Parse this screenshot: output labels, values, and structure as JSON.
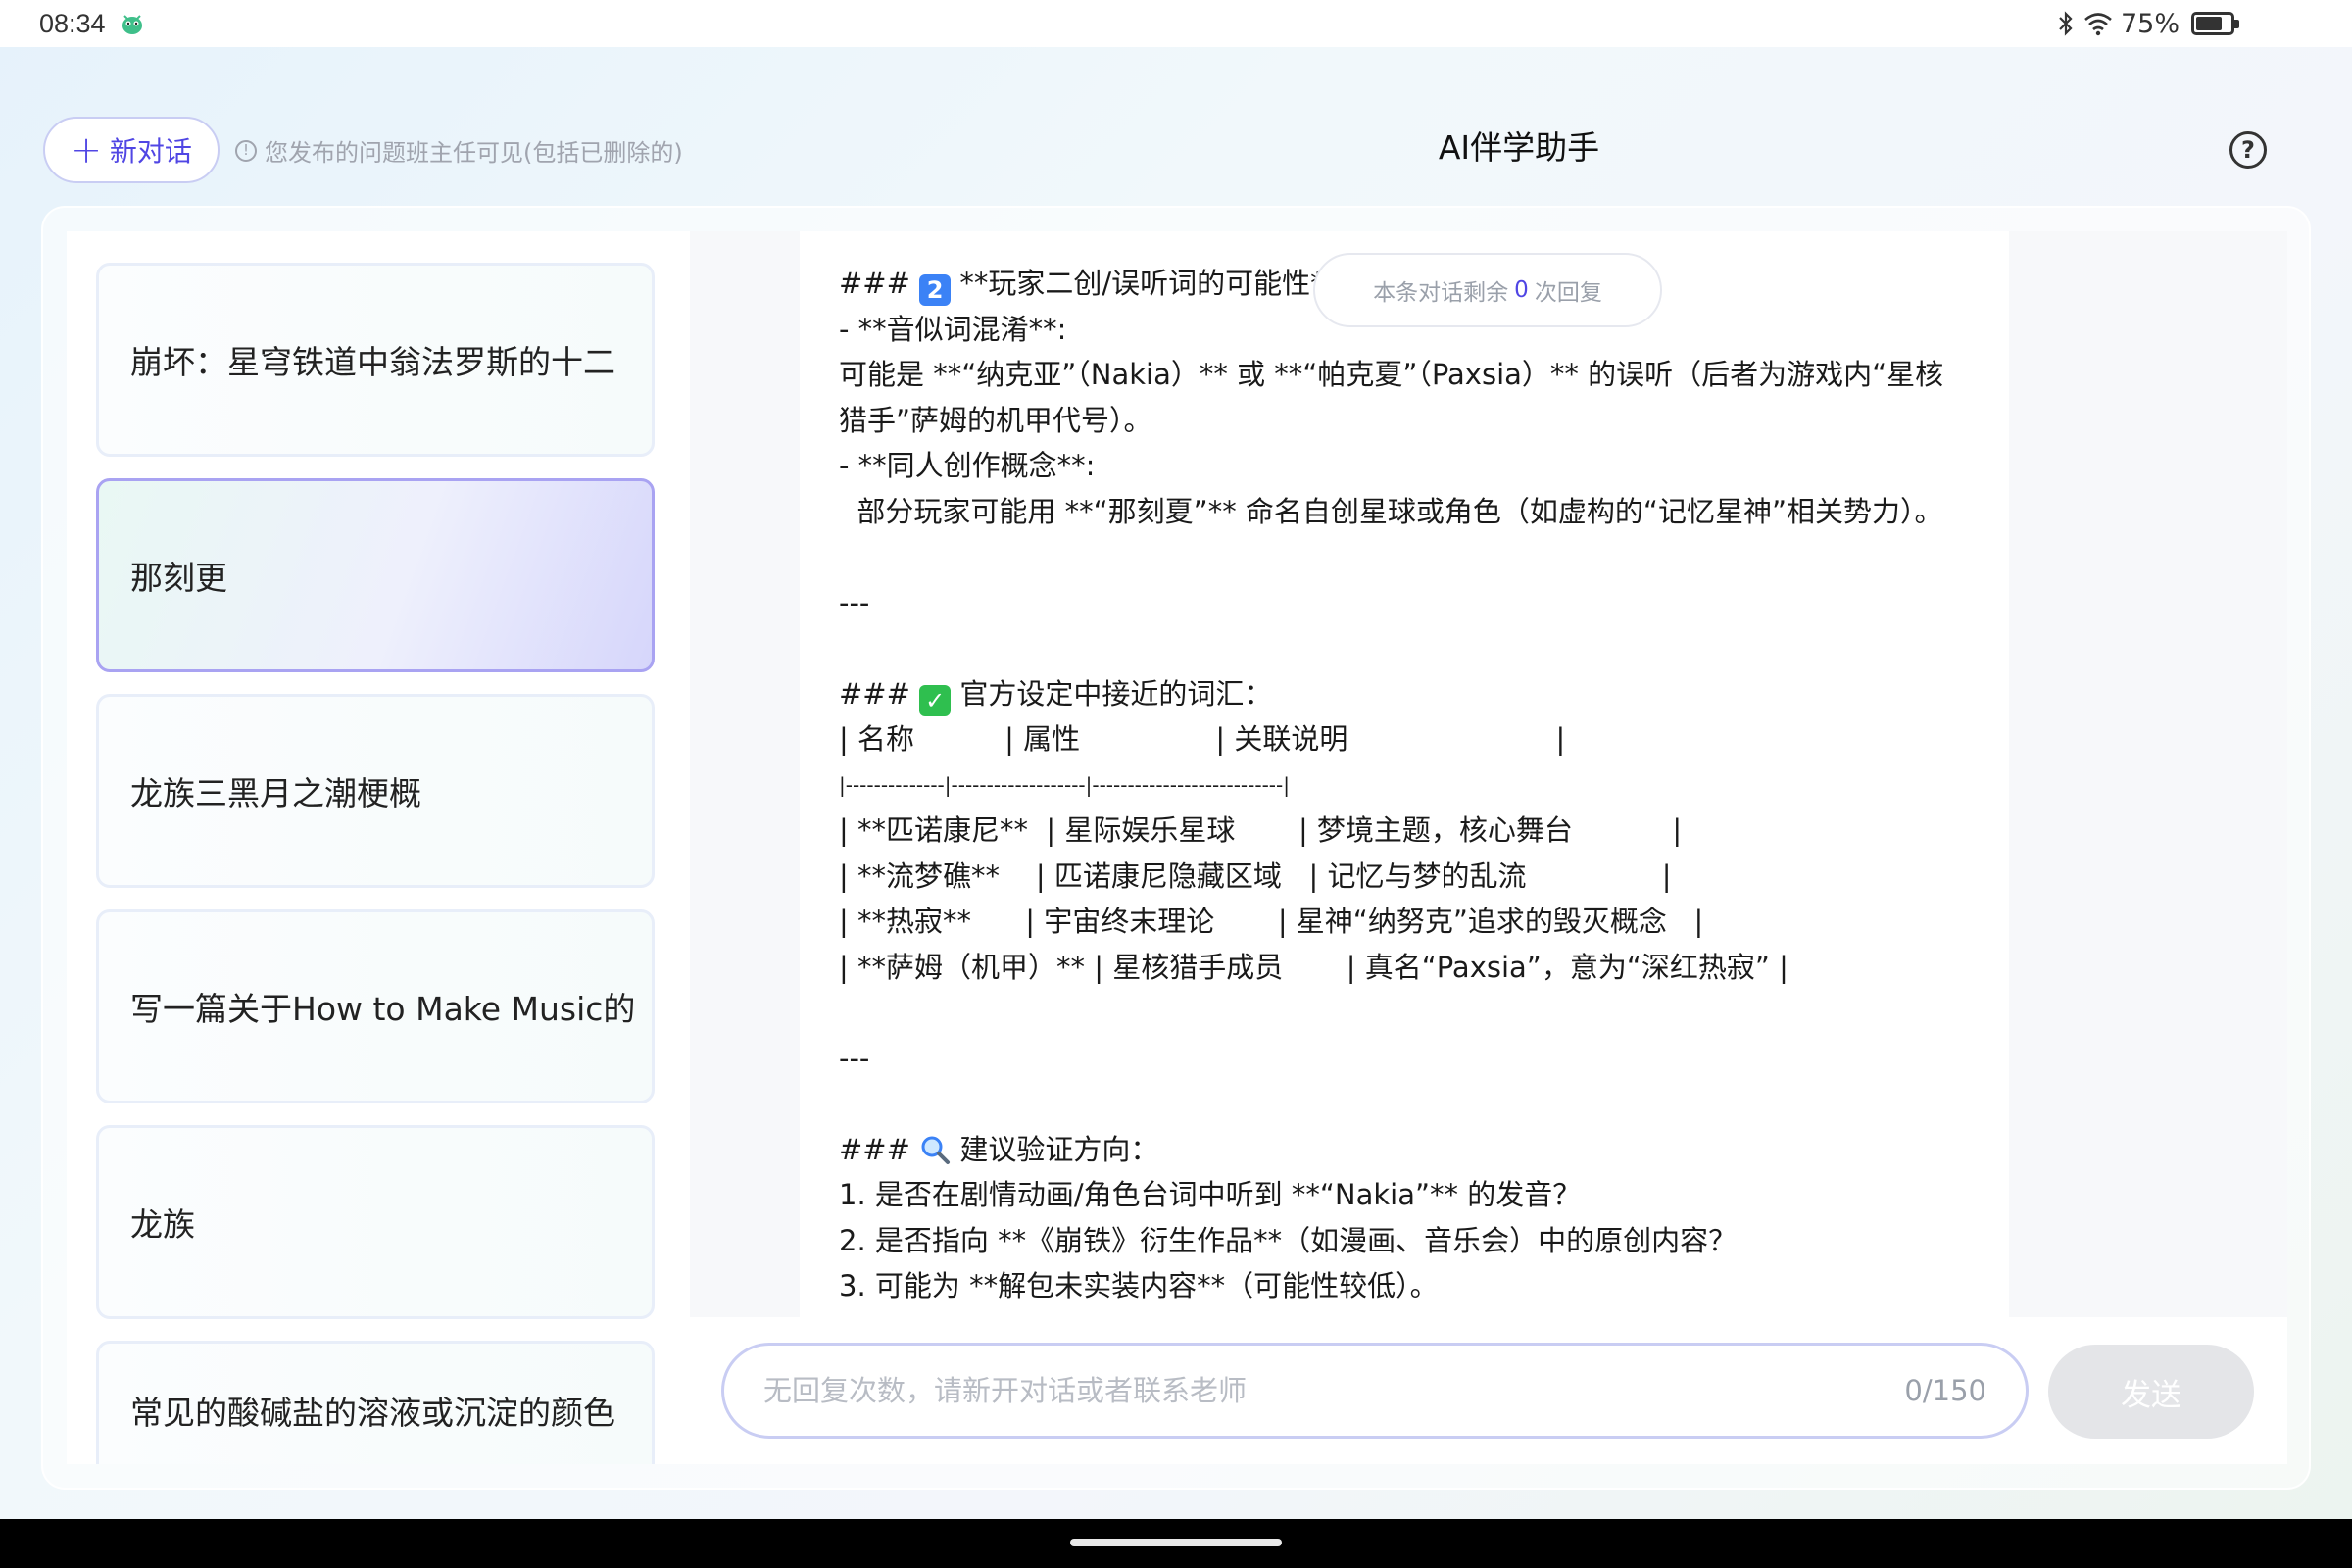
{
  "status_bar": {
    "time": "08:34",
    "battery": "75%",
    "battery_level": 0.75,
    "icons": [
      "bug-icon",
      "bluetooth-icon",
      "wifi-icon",
      "battery-icon"
    ]
  },
  "header": {
    "new_chat_label": "新对话",
    "notice": "您发布的问题班主任可见(包括已删除的)",
    "title": "AI伴学助手"
  },
  "sidebar": {
    "items": [
      {
        "label": "崩坏：星穹铁道中翁法罗斯的十二"
      },
      {
        "label": "那刻更"
      },
      {
        "label": "龙族三黑月之潮梗概"
      },
      {
        "label": "写一篇关于How to Make Music的"
      },
      {
        "label": "龙族"
      },
      {
        "label": "常见的酸碱盐的溶液或沉淀的颜色"
      }
    ]
  },
  "chat": {
    "remaining_prefix": "本条对话剩余",
    "remaining_count": "0",
    "remaining_suffix": "次回复",
    "lines": {
      "l1_prefix": "### ",
      "l1_badge": "2",
      "l1_text": " **玩家二创/误听词的可能性**",
      "l2": "- **音似词混淆**:",
      "l3": "  可能是 **“纳克亚”（Nakia）** 或 **“帕克夏”（Paxsia）** 的误听（后者为游戏内“星核猎手”萨姆的机甲代号）。",
      "l4": "- **同人创作概念**:",
      "l5": "  部分玩家可能用 **“那刻夏”** 命名自创星球或角色（如虚构的“记忆星神”相关势力）。",
      "sep1": "---",
      "h2_prefix": "### ",
      "h2_text": " 官方设定中接近的词汇：",
      "t_head": "| 名称          | 属性               | 关联说明                       |",
      "t_sep": "|--------------|-------------------|---------------------------|",
      "t_r1": "| **匹诺康尼**  | 星际娱乐星球       | 梦境主题，核心舞台           |",
      "t_r2": "| **流梦礁**    | 匹诺康尼隐藏区域   | 记忆与梦的乱流               |",
      "t_r3": "| **热寂**      | 宇宙终末理论       | 星神“纳努克”追求的毁灭概念   |",
      "t_r4": "| **萨姆（机甲）** | 星核猎手成员       | 真名“Paxsia”，意为“深红热寂” |",
      "sep2": "---",
      "h3_prefix": "### ",
      "h3_text": " 建议验证方向：",
      "q1": "1. 是否在剧情动画/角色台词中听到 **“Nakia”** 的发音？",
      "q2": "2. 是否指向 **《崩铁》衍生作品**（如漫画、音乐会）中的原创内容？",
      "q3": "3. 可能为 **解包未实装内容**（可能性较低）。"
    }
  },
  "input": {
    "placeholder": "无回复次数，请新开对话或者联系老师",
    "counter": "0/150",
    "send_label": "发送"
  },
  "colors": {
    "accent": "#5046e4",
    "check_emoji": "#2fbf4f",
    "keycap": "#3b82f6"
  }
}
